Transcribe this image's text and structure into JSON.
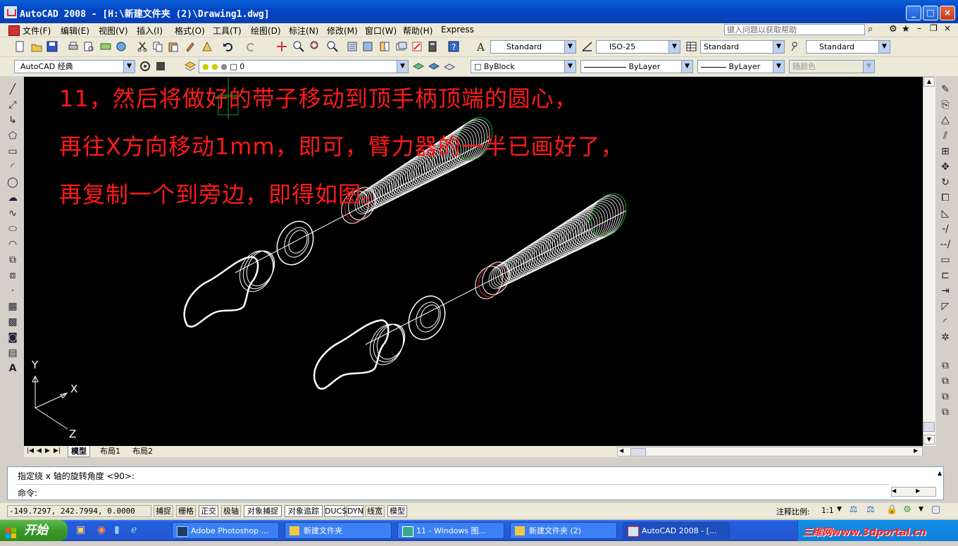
{
  "window": {
    "title": "AutoCAD 2008 - [H:\\新建文件夹 (2)\\Drawing1.dwg]",
    "buttons": {
      "minimize": "_",
      "maximize": "□",
      "close": "×"
    }
  },
  "menu": {
    "items": [
      "文件(F)",
      "编辑(E)",
      "视图(V)",
      "插入(I)",
      "格式(O)",
      "工具(T)",
      "绘图(D)",
      "标注(N)",
      "修改(M)",
      "窗口(W)",
      "帮助(H)",
      "Express"
    ],
    "help_placeholder": "键入问题以获取帮助"
  },
  "styles_toolbar": {
    "text_style": "Standard",
    "dim_style": "ISO-25",
    "table_style": "Standard",
    "multileader_style": "Standard"
  },
  "workspace_toolbar": {
    "workspace": "AutoCAD 经典",
    "layer": "0",
    "color": "ByBlock",
    "linetype": "ByLayer",
    "lineweight": "ByLayer",
    "plotstyle": "随颜色"
  },
  "instructions": [
    "11，然后将做好的带子移动到顶手柄顶端的圆心，",
    "再往X方向移动1mm，即可，臂力器的一半已画好了，",
    "再复制一个到旁边，即得如图。"
  ],
  "ucs": {
    "x": "X",
    "y": "Y",
    "z": "Z"
  },
  "tabs": [
    "模型",
    "布局1",
    "布局2"
  ],
  "command": {
    "history": "指定绕 x 轴的旋转角度 <90>:",
    "prompt": "命令:"
  },
  "status": {
    "coords": "-149.7297, 242.7994, 0.0000",
    "toggles": [
      "捕捉",
      "栅格",
      "正交",
      "极轴",
      "对象捕捉",
      "对象追踪",
      "DUCS",
      "DYN",
      "线宽",
      "模型"
    ],
    "annotation_scale_label": "注释比例:",
    "annotation_scale": "1:1"
  },
  "taskbar": {
    "start": "开始",
    "tasks": [
      "Adobe Photoshop ...",
      "新建文件夹",
      "11 - Windows 图...",
      "新建文件夹 (2)",
      "AutoCAD 2008 - [..."
    ],
    "watermark": "三维网www.3dportal.cn"
  },
  "colors": {
    "instruction_text": "#ff1a1a",
    "canvas": "#000000",
    "titlebar": "#0a5fd6"
  }
}
